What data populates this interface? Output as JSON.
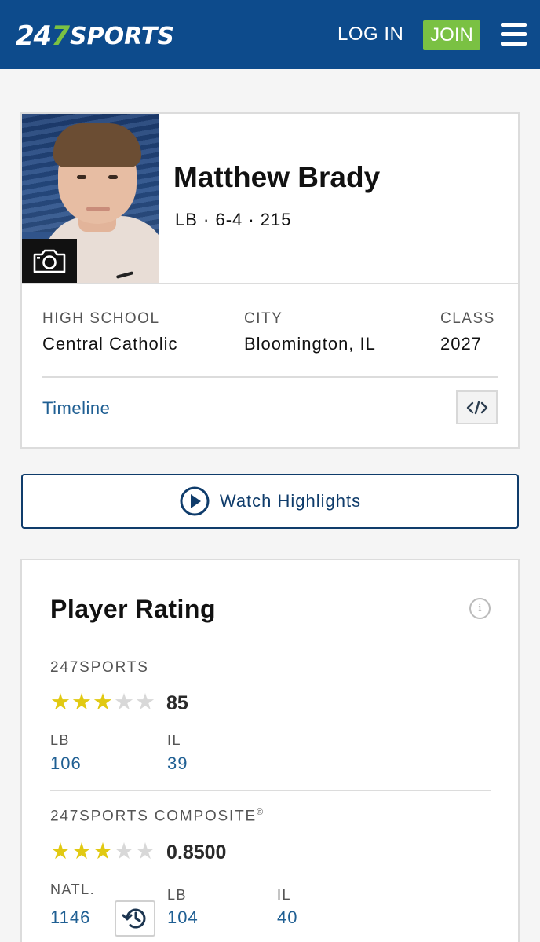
{
  "header": {
    "logo_num": "24",
    "logo_seven": "7",
    "logo_word": "SPORTS",
    "login_label": "LOG IN",
    "join_label": "JOIN",
    "colors": {
      "bar": "#0d4b8c",
      "accent": "#7ac143"
    }
  },
  "player": {
    "name": "Matthew Brady",
    "meta": "LB · 6-4 · 215",
    "photo_icon": "camera-icon"
  },
  "school_info": [
    {
      "label": "HIGH SCHOOL",
      "value": "Central Catholic"
    },
    {
      "label": "CITY",
      "value": "Bloomington, IL"
    },
    {
      "label": "CLASS",
      "value": "2027"
    }
  ],
  "timeline_label": "Timeline",
  "embed_icon": "code-embed-icon",
  "highlights": {
    "label": "Watch Highlights",
    "icon": "play-circle-icon"
  },
  "rating": {
    "title": "Player Rating",
    "info_icon": "i",
    "sports247": {
      "label": "247SPORTS",
      "stars": 3,
      "max_stars": 5,
      "score": "85",
      "ranks": [
        {
          "label": "LB",
          "value": "106"
        },
        {
          "label": "IL",
          "value": "39"
        }
      ]
    },
    "composite": {
      "label": "247SPORTS COMPOSITE",
      "reg": "®",
      "stars": 3,
      "max_stars": 5,
      "score": "0.8500",
      "ranks": [
        {
          "label": "NATL.",
          "value": "1146"
        },
        {
          "label": "LB",
          "value": "104"
        },
        {
          "label": "IL",
          "value": "40"
        }
      ],
      "history_icon": "history-icon"
    }
  }
}
